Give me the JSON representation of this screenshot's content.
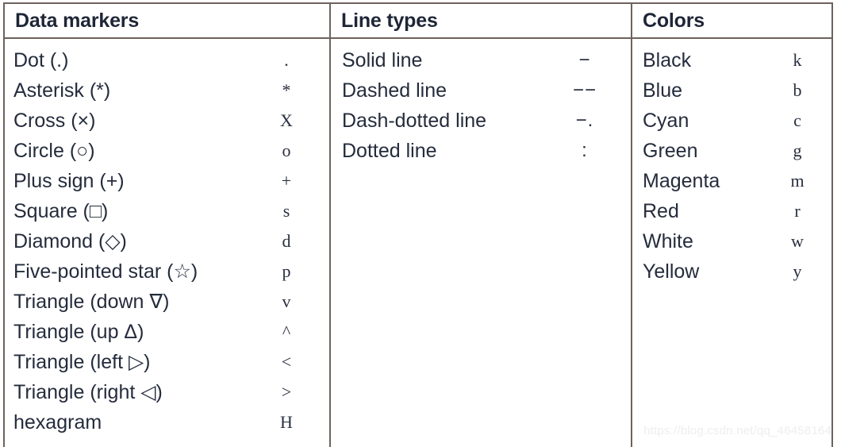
{
  "columns": [
    {
      "header": "Data markers",
      "code_header": "",
      "rows": [
        {
          "label": "Dot (.)",
          "code": "."
        },
        {
          "label": "Asterisk (*)",
          "code": "*"
        },
        {
          "label": "Cross (×)",
          "code": "X"
        },
        {
          "label": "Circle (○)",
          "code": "o"
        },
        {
          "label": "Plus sign (+)",
          "code": "+"
        },
        {
          "label": "Square (□)",
          "code": "s"
        },
        {
          "label": "Diamond (◇)",
          "code": "d"
        },
        {
          "label": "Five-pointed star (☆)",
          "code": "p"
        },
        {
          "label": "Triangle (down ∇)",
          "code": "v"
        },
        {
          "label": "Triangle (up Δ)",
          "code": "^"
        },
        {
          "label": "Triangle (left ▷)",
          "code": "<"
        },
        {
          "label": "Triangle (right ◁)",
          "code": ">"
        },
        {
          "label": "hexagram",
          "code": "H"
        }
      ]
    },
    {
      "header": "Line types",
      "code_header": "",
      "rows": [
        {
          "label": "Solid line",
          "code": "−"
        },
        {
          "label": "Dashed line",
          "code": "−−"
        },
        {
          "label": "Dash-dotted line",
          "code": "−."
        },
        {
          "label": "Dotted line",
          "code": ":"
        }
      ]
    },
    {
      "header": "Colors",
      "code_header": "",
      "rows": [
        {
          "label": "Black",
          "code": "k"
        },
        {
          "label": "Blue",
          "code": "b"
        },
        {
          "label": "Cyan",
          "code": "c"
        },
        {
          "label": "Green",
          "code": "g"
        },
        {
          "label": "Magenta",
          "code": "m"
        },
        {
          "label": "Red",
          "code": "r"
        },
        {
          "label": "White",
          "code": "w"
        },
        {
          "label": "Yellow",
          "code": "y"
        }
      ]
    }
  ],
  "watermark": "https://blog.csdn.net/qq_46458164",
  "colors": {
    "border": "#6e625c",
    "text": "#242c3c",
    "background": "#ffffff",
    "watermark": "#eeeeee"
  }
}
